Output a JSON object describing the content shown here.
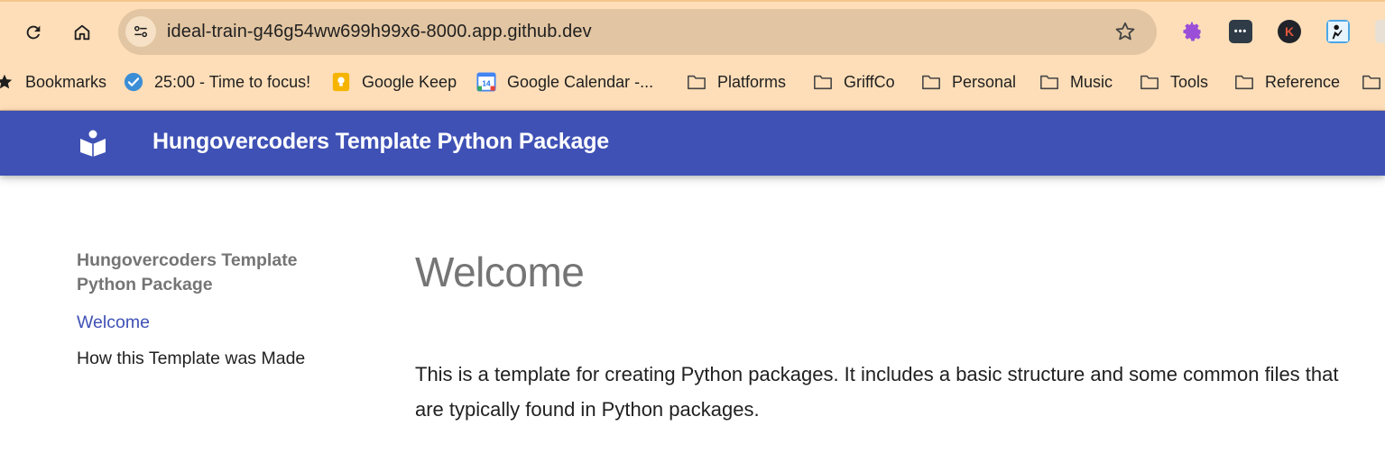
{
  "browser": {
    "url": "ideal-train-g46g54ww699h99x6-8000.app.github.dev",
    "nav": [
      {
        "name": "reload-icon"
      },
      {
        "name": "home-icon"
      }
    ],
    "extensions": [
      {
        "name": "gear-extension-icon",
        "color": "#9b4fd8"
      },
      {
        "name": "password-extension-icon",
        "color": "#2f3b46"
      },
      {
        "name": "k-extension-icon",
        "label": "K",
        "color": "#e0553b"
      },
      {
        "name": "reader-extension-icon",
        "color": "#4aa7e8"
      }
    ],
    "bookmarks": [
      {
        "label": "Bookmarks",
        "icon": "star-icon"
      },
      {
        "label": "25:00 - Time to focus!",
        "icon": "check-circle-icon"
      },
      {
        "label": "Google Keep",
        "icon": "keep-icon"
      },
      {
        "label": "Google Calendar -...",
        "icon": "calendar-icon",
        "badge": "14"
      },
      {
        "label": "Platforms",
        "icon": "folder-icon"
      },
      {
        "label": "GriffCo",
        "icon": "folder-icon"
      },
      {
        "label": "Personal",
        "icon": "folder-icon"
      },
      {
        "label": "Music",
        "icon": "folder-icon"
      },
      {
        "label": "Tools",
        "icon": "folder-icon"
      },
      {
        "label": "Reference",
        "icon": "folder-icon"
      }
    ],
    "colors": {
      "chrome": "#fedeb8",
      "omnibox": "#e2c5a2"
    }
  },
  "site": {
    "title": "Hungovercoders Template Python Package",
    "logo_icon": "book-reader-icon",
    "colors": {
      "primary": "#3f51b5"
    }
  },
  "sidebar": {
    "heading": "Hungovercoders Template Python Package",
    "items": [
      {
        "label": "Welcome",
        "active": true
      },
      {
        "label": "How this Template was Made",
        "active": false
      }
    ]
  },
  "main": {
    "heading": "Welcome",
    "paragraph": "This is a template for creating Python packages. It includes a basic structure and some common files that are typically found in Python packages."
  }
}
